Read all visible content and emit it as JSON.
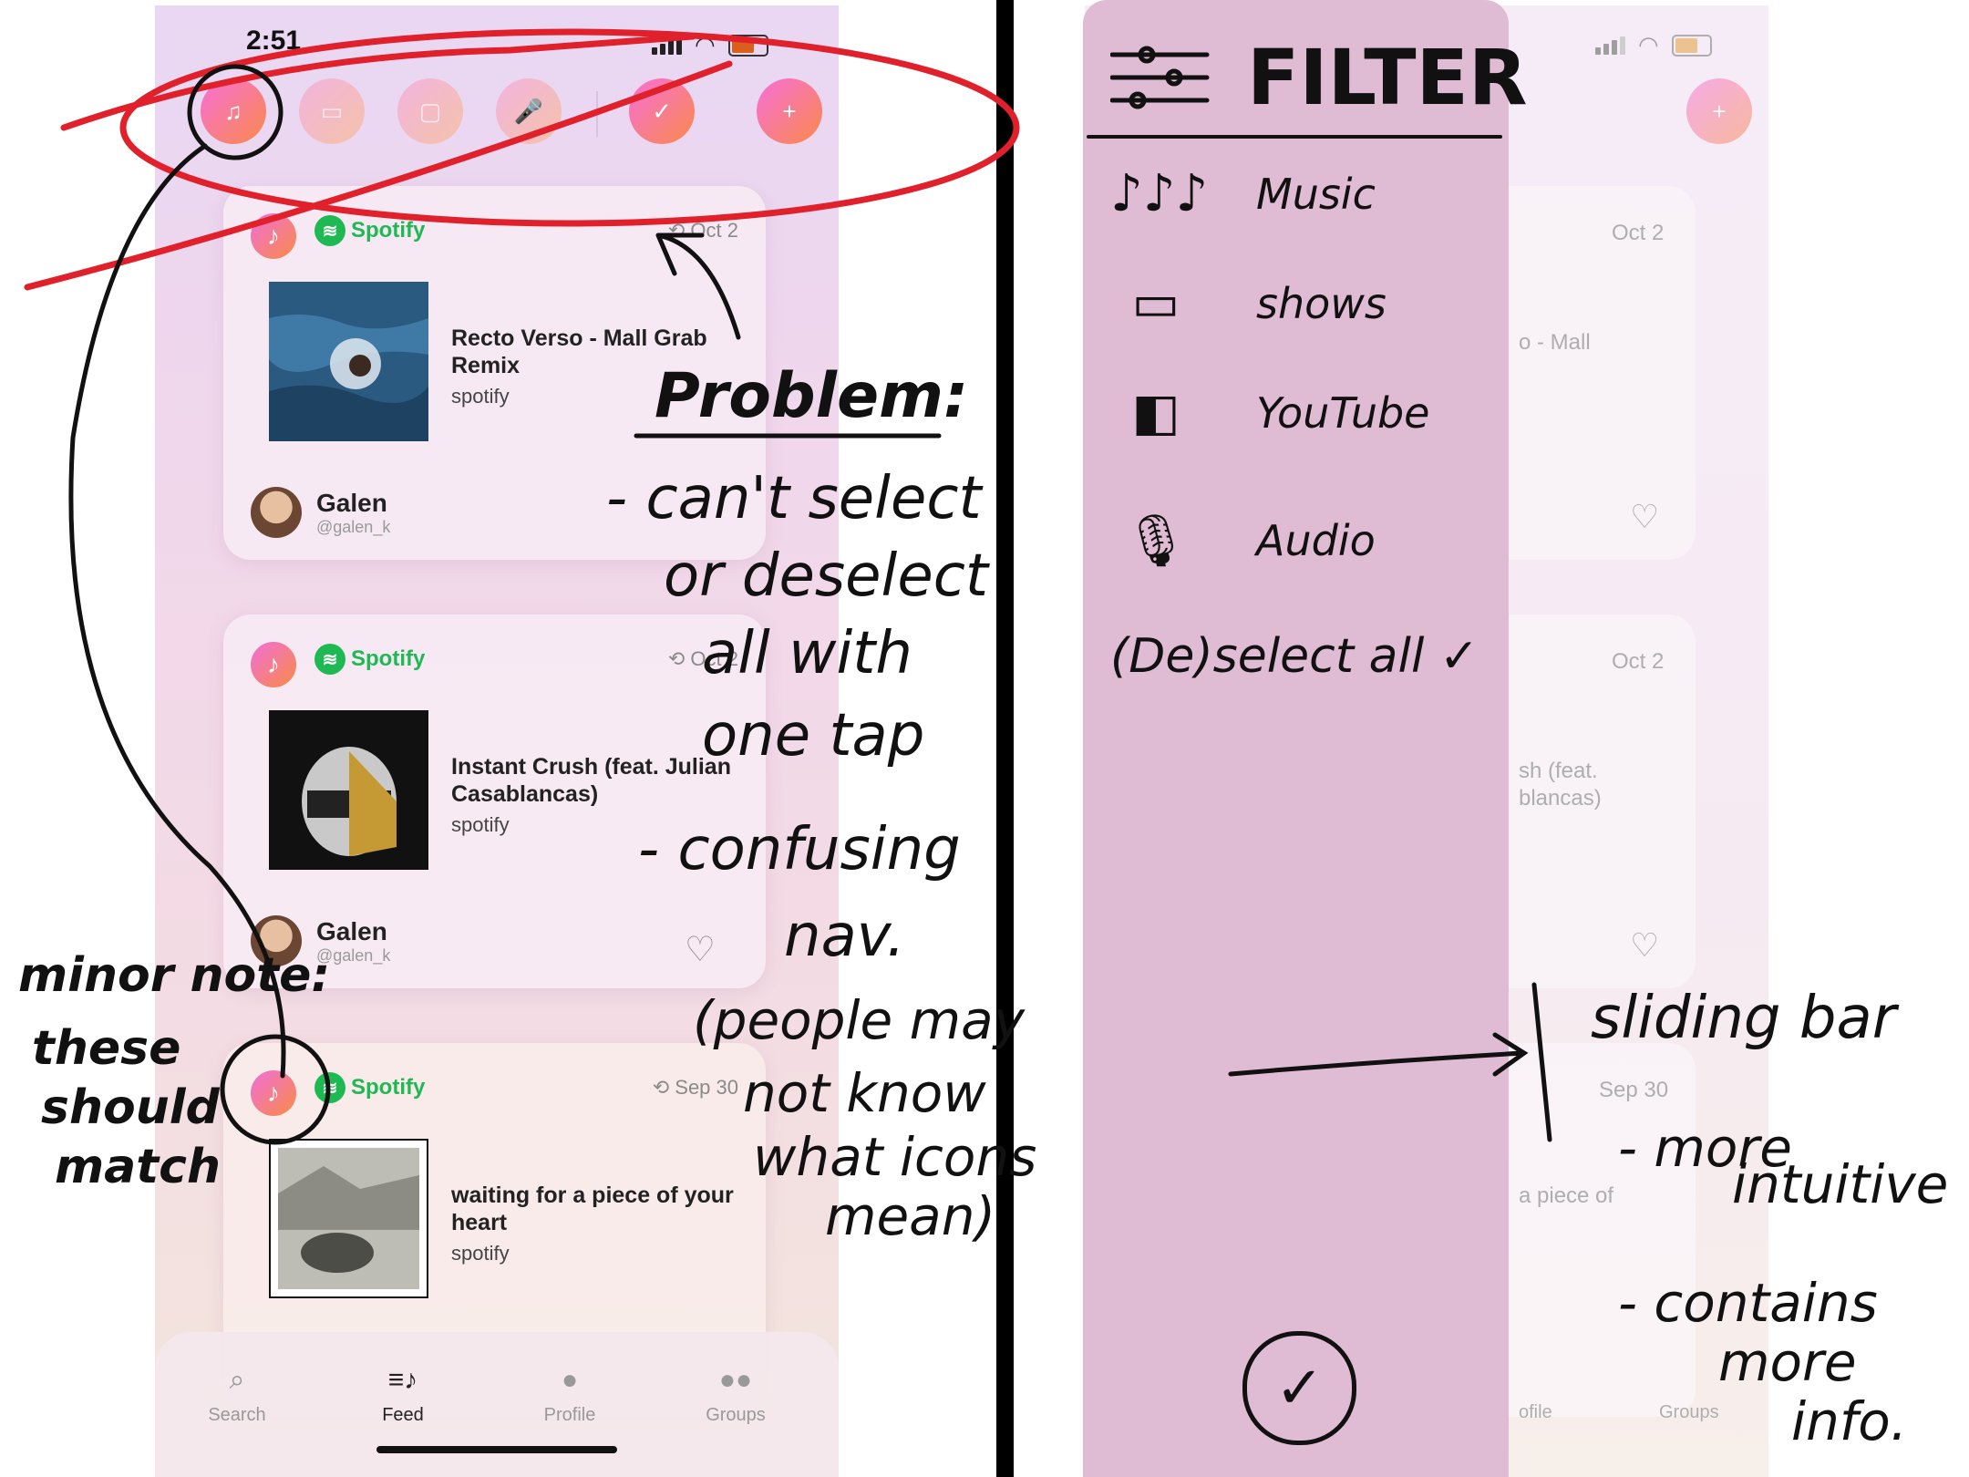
{
  "left_phone": {
    "status_time": "2:51",
    "filters": [
      {
        "name": "music",
        "glyph": "♫",
        "state": "on"
      },
      {
        "name": "shows",
        "glyph": "▭",
        "state": "off"
      },
      {
        "name": "youtube",
        "glyph": "▢",
        "state": "off"
      },
      {
        "name": "audio",
        "glyph": "🎤",
        "state": "off"
      },
      {
        "name": "select-all",
        "glyph": "✓",
        "state": "on"
      },
      {
        "name": "add",
        "glyph": "+",
        "state": "on"
      }
    ],
    "cards": [
      {
        "service": "Spotify",
        "date": "Oct 2",
        "title": "Recto Verso - Mall Grab Remix",
        "source": "spotify",
        "user": "Galen",
        "handle": "@galen_k"
      },
      {
        "service": "Spotify",
        "date": "Oct 2",
        "title": "Instant Crush (feat. Julian Casablancas)",
        "source": "spotify",
        "user": "Galen",
        "handle": "@galen_k"
      },
      {
        "service": "Spotify",
        "date": "Sep 30",
        "title": "waiting for a piece of your heart",
        "source": "spotify"
      }
    ],
    "tabs": [
      {
        "label": "Search",
        "icon": "search-icon"
      },
      {
        "label": "Feed",
        "icon": "feed-icon",
        "active": true
      },
      {
        "label": "Profile",
        "icon": "profile-icon"
      },
      {
        "label": "Groups",
        "icon": "groups-icon"
      }
    ]
  },
  "right_phone": {
    "visible_fragments": [
      "Oct 2",
      "o - Mall",
      "Oct 2",
      "sh (feat.",
      "blancas)",
      "Sep 30",
      "a piece of",
      "ofile",
      "Groups"
    ]
  },
  "filter_panel": {
    "title": "FILTER",
    "items": [
      {
        "icon": "music-notes-icon",
        "glyph": "♪♪♪",
        "label": "Music"
      },
      {
        "icon": "tv-icon",
        "glyph": "▭",
        "label": "shows"
      },
      {
        "icon": "video-camera-icon",
        "glyph": "◧",
        "label": "YouTube"
      },
      {
        "icon": "microphone-icon",
        "glyph": "🎙",
        "label": "Audio"
      }
    ],
    "select_all": "(De)select all ✓",
    "confirm_glyph": "✓"
  },
  "annotations": {
    "problem_heading": "Problem:",
    "problem_1": "- can't select",
    "problem_2": "or deselect",
    "problem_3": "all with",
    "problem_4": "one tap",
    "problem_5": "- confusing",
    "problem_6": "nav.",
    "problem_7": "(people may",
    "problem_8": "not know",
    "problem_9": "what icons",
    "problem_10": "mean)",
    "minor_1": "minor note:",
    "minor_2": "these",
    "minor_3": "should",
    "minor_4": "match",
    "sliding_1": "sliding bar",
    "sliding_2": "- more",
    "sliding_3": "intuitive",
    "sliding_4": "- contains",
    "sliding_5": "more",
    "sliding_6": "info."
  },
  "colors": {
    "pen_red": "#e0202a",
    "pen_black": "#111111",
    "panel": "#dfbcd3",
    "spotify_green": "#1fb954"
  }
}
